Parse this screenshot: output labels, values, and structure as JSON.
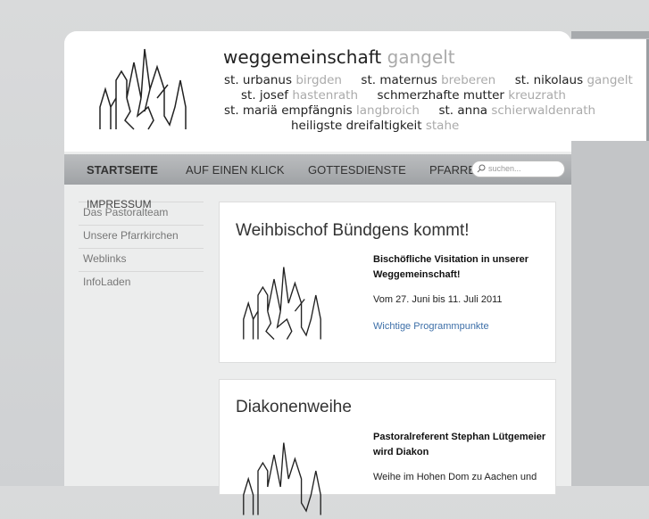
{
  "header": {
    "title": "weggemeinschaft",
    "title_place": "gangelt",
    "parishes": [
      [
        {
          "saint": "st. urbanus",
          "place": "birgden"
        },
        {
          "saint": "st. maternus",
          "place": "breberen"
        },
        {
          "saint": "st. nikolaus",
          "place": "gangelt"
        }
      ],
      [
        {
          "saint": "st. josef",
          "place": "hastenrath"
        },
        {
          "saint": "schmerzhafte mutter",
          "place": "kreuzrath"
        }
      ],
      [
        {
          "saint": "st. mariä empfängnis",
          "place": "langbroich"
        },
        {
          "saint": "st. anna",
          "place": "schierwaldenrath"
        }
      ],
      [
        {
          "saint": "heiligste dreifaltigkeit",
          "place": "stahe"
        }
      ]
    ]
  },
  "nav": {
    "items": [
      "STARTSEITE",
      "AUF EINEN KLICK",
      "GOTTESDIENSTE",
      "PFARRBRIEF"
    ],
    "overflow_item": "IMPRESSUM"
  },
  "search": {
    "placeholder": "suchen..."
  },
  "sidebar": {
    "items": [
      "Das Pastoralteam",
      "Unsere Pfarrkirchen",
      "Weblinks",
      "InfoLaden"
    ]
  },
  "articles": [
    {
      "title": "Weihbischof Bündgens kommt!",
      "lead": "Bischöfliche Visitation in unserer Weggemeinschaft!",
      "text": "Vom 27. Juni bis 11. Juli 2011",
      "link": "Wichtige Programmpunkte"
    },
    {
      "title": "Diakonenweihe",
      "lead": "Pastoralreferent Stephan Lütgemeier wird Diakon",
      "text": "Weihe im Hohen Dom zu Aachen und"
    }
  ]
}
